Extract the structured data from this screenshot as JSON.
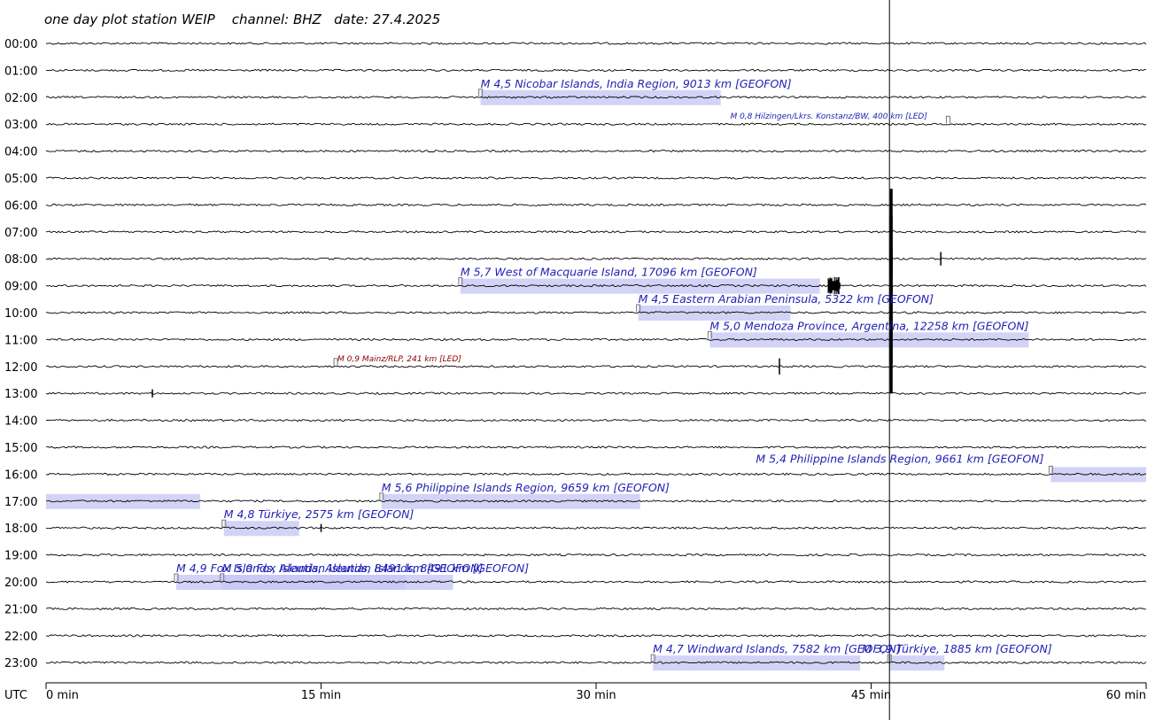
{
  "chart_data": {
    "type": "helicorder",
    "title": "one day plot station WEIP    channel: BHZ   date: 27.4.2025",
    "timezone_label": "UTC",
    "x_unit": "min",
    "xlim": [
      0,
      60
    ],
    "x_ticks": [
      {
        "value": 0,
        "label": "0 min"
      },
      {
        "value": 15,
        "label": "15 min"
      },
      {
        "value": 30,
        "label": "30 min"
      },
      {
        "value": 45,
        "label": "45 min"
      },
      {
        "value": 60,
        "label": "60 min"
      }
    ],
    "hour_labels": [
      "00:00",
      "01:00",
      "02:00",
      "03:00",
      "04:00",
      "05:00",
      "06:00",
      "07:00",
      "08:00",
      "09:00",
      "10:00",
      "11:00",
      "12:00",
      "13:00",
      "14:00",
      "15:00",
      "16:00",
      "17:00",
      "18:00",
      "19:00",
      "20:00",
      "21:00",
      "22:00",
      "23:00"
    ],
    "colors": {
      "trace": "#000000",
      "event_text": "#1f1fb4",
      "event_window": "#c8c8f5",
      "local_event_text": "#8b0000"
    },
    "events": [
      {
        "label": "M 4,5 Nicobar Islands, India Region, 9013 km  [GEOFON]",
        "hour": 2,
        "start_min": 23.7,
        "end_min": 36.8,
        "style": "teleseism"
      },
      {
        "label": "M 0,8 Hilzingen/Lkrs. Konstanz/BW, 400 km  [LED]",
        "hour": 3,
        "start_min": 49.2,
        "end_min": 49.5,
        "style": "small"
      },
      {
        "label": "M 5,7 West of Macquarie Island, 17096 km  [GEOFON]",
        "hour": 9,
        "start_min": 22.6,
        "end_min": 42.2,
        "style": "teleseism"
      },
      {
        "label": "M 4,5 Eastern Arabian Peninsula, 5322 km  [GEOFON]",
        "hour": 10,
        "start_min": 32.3,
        "end_min": 40.6,
        "style": "teleseism"
      },
      {
        "label": "M 5,0 Mendoza Province, Argentina, 12258 km  [GEOFON]",
        "hour": 11,
        "start_min": 36.2,
        "end_min": 53.6,
        "style": "teleseism"
      },
      {
        "label": "M 0,9 Mainz/RLP, 241 km  [LED]",
        "hour": 12,
        "start_min": 15.8,
        "end_min": 16.1,
        "style": "local"
      },
      {
        "label": "M 5,4 Philippine Islands Region, 9661 km  [GEOFON]",
        "hour": 16,
        "start_min": 54.8,
        "end_min": 60,
        "style": "teleseism"
      },
      {
        "label": "M 5,6 Philippine Islands Region, 9659 km  [GEOFON]",
        "hour": 17,
        "start_min": 18.3,
        "end_min": 32.4,
        "style": "teleseism"
      },
      {
        "label": "M 4,8 Türkiye, 2575 km  [GEOFON]",
        "hour": 18,
        "start_min": 9.7,
        "end_min": 13.8,
        "style": "teleseism"
      },
      {
        "label": "M 4,9 Fox Islands, Aleutian Islands, 8491 km  [GEOFON]",
        "hour": 20,
        "start_min": 7.1,
        "end_min": 22.2,
        "style": "teleseism"
      },
      {
        "label": "M 5,0 Fox Islands, Aleutian Islands, 8491 km  [GEOFON]",
        "hour": 20,
        "start_min": 9.6,
        "end_min": 19.6,
        "style": "teleseism"
      },
      {
        "label": "M 4,7 Windward Islands, 7582 km  [GEOFON]",
        "hour": 23,
        "start_min": 33.1,
        "end_min": 44.4,
        "style": "teleseism"
      },
      {
        "label": "M 3,9 Türkiye, 1885 km  [GEOFON]",
        "hour": 23,
        "start_min": 46.0,
        "end_min": 49.0,
        "style": "teleseism"
      }
    ],
    "carryover_windows": [
      {
        "hour": 17,
        "start_min": 0,
        "end_min": 8.4
      }
    ],
    "signals": [
      {
        "hour": 7,
        "minute": 46.1,
        "kind": "large_spike",
        "amplitude": 1.6
      },
      {
        "hour": 8,
        "minute": 46.1,
        "kind": "large_spike",
        "amplitude": 1.6
      },
      {
        "hour": 8,
        "minute": 48.8,
        "kind": "spike",
        "amplitude": 0.25
      },
      {
        "hour": 9,
        "minute": 43.0,
        "kind": "burst",
        "amplitude": 0.35
      },
      {
        "hour": 9,
        "minute": 46.1,
        "kind": "large_spike",
        "amplitude": 1.4
      },
      {
        "hour": 10,
        "minute": 46.1,
        "kind": "large_spike",
        "amplitude": 1.0
      },
      {
        "hour": 11,
        "minute": 46.1,
        "kind": "large_spike",
        "amplitude": 0.9
      },
      {
        "hour": 12,
        "minute": 46.1,
        "kind": "large_spike",
        "amplitude": 1.0
      },
      {
        "hour": 12,
        "minute": 40.0,
        "kind": "spike",
        "amplitude": 0.3
      },
      {
        "hour": 13,
        "minute": 5.8,
        "kind": "spike",
        "amplitude": 0.15
      },
      {
        "hour": 18,
        "minute": 15.0,
        "kind": "spike",
        "amplitude": 0.15
      }
    ]
  }
}
